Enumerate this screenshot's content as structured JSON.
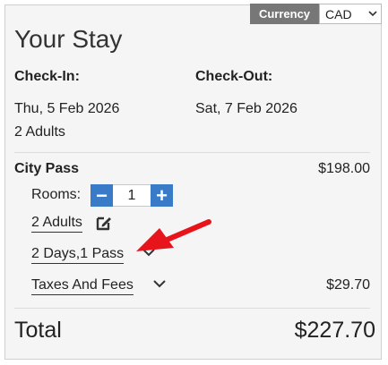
{
  "currency": {
    "label": "Currency",
    "selected": "CAD"
  },
  "title": "Your Stay",
  "checkin": {
    "label": "Check-In:",
    "date": "Thu, 5 Feb 2026"
  },
  "checkout": {
    "label": "Check-Out:",
    "date": "Sat, 7 Feb 2026"
  },
  "guests": "2 Adults",
  "room": {
    "name": "City Pass",
    "price": "$198.00",
    "rooms_label": "Rooms:",
    "rooms_count": "1",
    "minus": "−",
    "plus": "+",
    "adults": "2 Adults",
    "package": "2 Days,1 Pass",
    "taxes_label": "Taxes And Fees",
    "taxes_value": "$29.70"
  },
  "total": {
    "label": "Total",
    "value": "$227.70"
  },
  "icons": {
    "edit": "edit-icon",
    "chevron": "chevron-down-icon",
    "arrow": "red-arrow-icon"
  },
  "colors": {
    "accent": "#3a7bc8",
    "arrow": "#e8141b",
    "currency_bg": "#777777"
  }
}
